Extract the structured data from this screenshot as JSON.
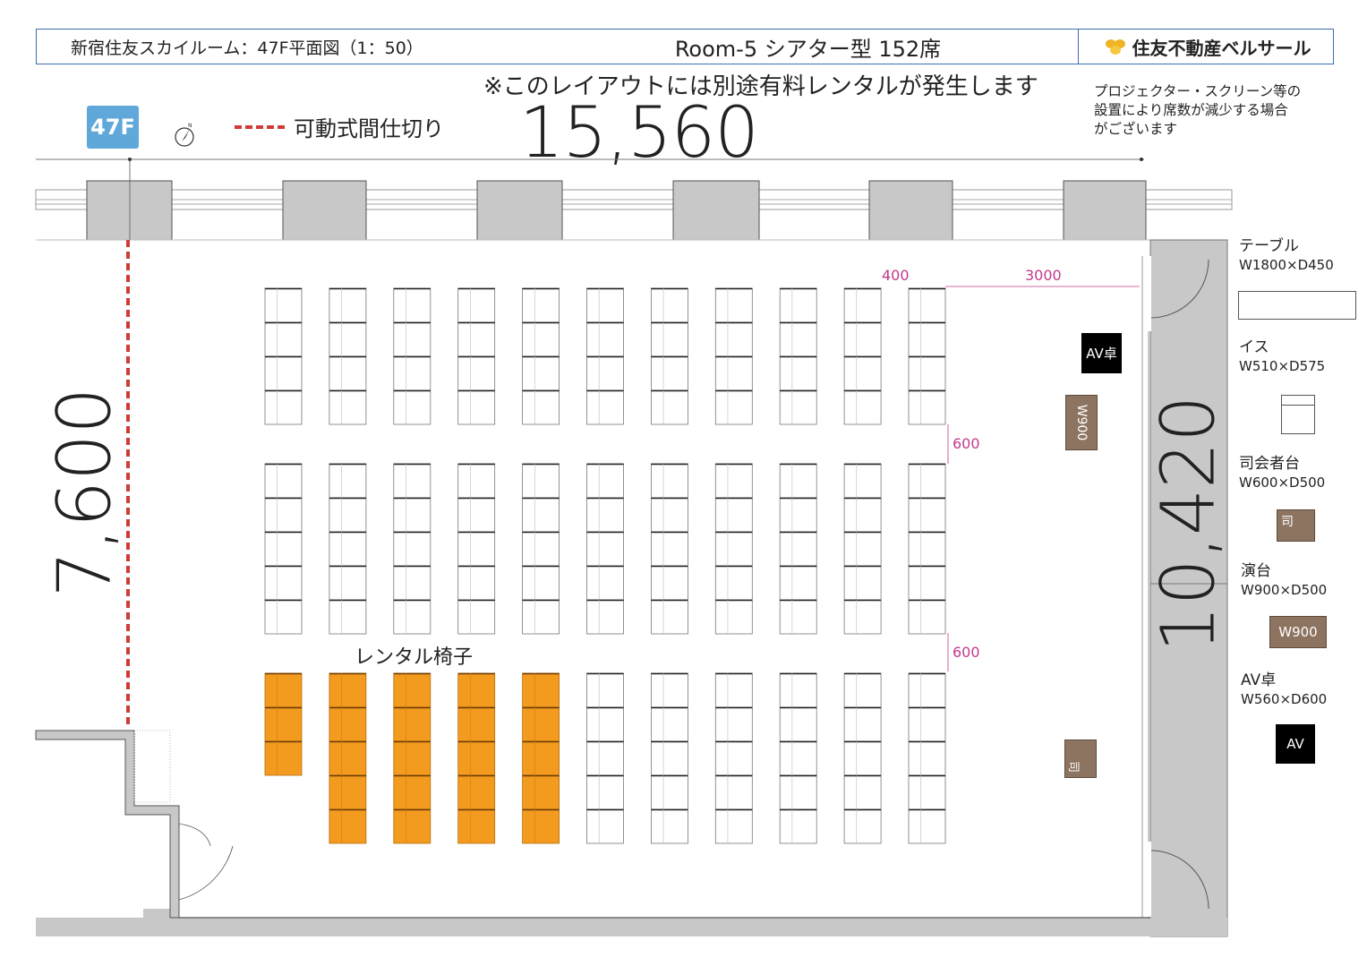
{
  "header": {
    "left_title": "新宿住友スカイルーム：47F平面図（1：50）",
    "center_title": "Room-5 シアター型 152席",
    "company": "住友不動産ベルサール"
  },
  "notice": "※このレイアウトには別途有料レンタルが発生します",
  "note_lines": [
    "プロジェクター・スクリーン等の",
    "設置により席数が減少する場合",
    "がございます"
  ],
  "floor_badge": "47F",
  "partition_legend": "可動式間仕切り",
  "dimensions": {
    "width": "15,560",
    "height_left": "7,600",
    "height_right": "10,420",
    "aisle_side": "400",
    "front_gap": "3000",
    "aisle_1": "600",
    "aisle_2": "600"
  },
  "rental_label": "レンタル椅子",
  "av_desk_label": "AV卓",
  "podium_label": "W900",
  "mc_stand_label": "司",
  "legend": {
    "table": {
      "title": "テーブル",
      "size": "W1800×D450"
    },
    "chair": {
      "title": "イス",
      "size": "W510×D575"
    },
    "mc": {
      "title": "司会者台",
      "size": "W600×D500",
      "mark": "司"
    },
    "podium": {
      "title": "演台",
      "size": "W900×D500",
      "mark": "W900"
    },
    "av": {
      "title": "AV卓",
      "size": "W560×D600",
      "mark": "AV"
    }
  },
  "layout": {
    "columns": 11,
    "blocks": [
      {
        "rows": 4,
        "rental_columns": 0
      },
      {
        "rows": 5,
        "rental_columns": 0
      },
      {
        "rows": 5,
        "rental_columns": 5,
        "first_column_rows": 3
      }
    ],
    "colors": {
      "rental": "#f39b1f",
      "partition": "#d13a36",
      "dimension": "#c23a8c",
      "header_border": "#3b6fb0",
      "badge": "#5fa8d9",
      "wood": "#8d7461"
    }
  }
}
